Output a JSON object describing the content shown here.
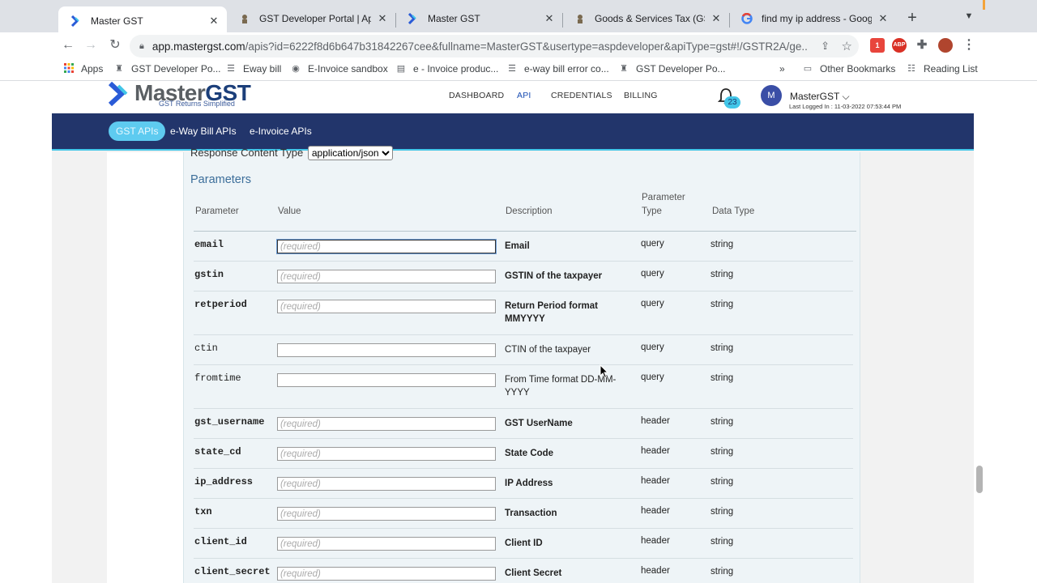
{
  "browser": {
    "tabs": [
      {
        "title": "Master GST",
        "favicon": "mastergst-favicon"
      },
      {
        "title": "GST Developer Portal | Apilist",
        "favicon": "gst-emblem-favicon"
      },
      {
        "title": "Master GST",
        "favicon": "mastergst-favicon"
      },
      {
        "title": "Goods & Services Tax (GST) | ",
        "favicon": "gst-emblem-favicon"
      },
      {
        "title": "find my ip address - Google Se",
        "favicon": "google-favicon"
      }
    ],
    "url_host": "app.mastergst.com",
    "url_rest": "/apis?id=6222f8d6b647b31842267cee&fullname=MasterGST&usertype=aspdeveloper&apiType=gst#!/GSTR2A/ge...",
    "bookmarks": [
      {
        "label": "Apps",
        "icon": "apps-grid-icon"
      },
      {
        "label": "GST Developer Po...",
        "icon": "gst-emblem-icon"
      },
      {
        "label": "Eway bill",
        "icon": "bookmark-icon"
      },
      {
        "label": "E-Invoice sandbox",
        "icon": "globe-icon"
      },
      {
        "label": "e - Invoice produc...",
        "icon": "page-icon"
      },
      {
        "label": "e-way bill error co...",
        "icon": "bookmark-icon"
      },
      {
        "label": "GST Developer Po...",
        "icon": "gst-emblem-icon"
      }
    ],
    "more_bookmarks": "»",
    "other_bookmarks": "Other Bookmarks",
    "reading_list": "Reading List",
    "ext_badge": "1",
    "abp": "ABP"
  },
  "site": {
    "logo_word_prefix": "Master",
    "logo_word_suffix": "GST",
    "logo_tagline": "GST Returns Simplified",
    "nav": [
      {
        "label": "DASHBOARD",
        "active": false
      },
      {
        "label": "API",
        "active": true
      },
      {
        "label": "CREDENTIALS",
        "active": false
      },
      {
        "label": "BILLING",
        "active": false
      }
    ],
    "notifications": "23",
    "avatar_letter": "M",
    "user_name": "MasterGST",
    "last_logged": "Last Logged In : 11-03-2022 07:53:44 PM",
    "subnav": [
      {
        "label": "GST APIs",
        "active": true
      },
      {
        "label": "e-Way Bill APIs",
        "active": false
      },
      {
        "label": "e-Invoice APIs",
        "active": false
      }
    ],
    "colors": {
      "navy": "#22356b",
      "accent": "#42c6e8",
      "link": "#1a4db3"
    }
  },
  "content": {
    "response_content_type_label": "Response Content Type",
    "response_content_type_value": "application/json",
    "parameters_title": "Parameters",
    "headers": {
      "parameter": "Parameter",
      "value": "Value",
      "description": "Description",
      "parameter_type": "Parameter Type",
      "data_type": "Data Type"
    },
    "rows": [
      {
        "name": "email",
        "required": true,
        "placeholder": "(required)",
        "description": "Email",
        "param_type": "query",
        "data_type": "string",
        "focused": true
      },
      {
        "name": "gstin",
        "required": true,
        "placeholder": "(required)",
        "description": "GSTIN of the taxpayer",
        "param_type": "query",
        "data_type": "string"
      },
      {
        "name": "retperiod",
        "required": true,
        "placeholder": "(required)",
        "description": "Return Period format MMYYYY",
        "param_type": "query",
        "data_type": "string"
      },
      {
        "name": "ctin",
        "required": false,
        "placeholder": "",
        "description": "CTIN of the taxpayer",
        "param_type": "query",
        "data_type": "string"
      },
      {
        "name": "fromtime",
        "required": false,
        "placeholder": "",
        "description": "From Time format DD-MM-YYYY",
        "param_type": "query",
        "data_type": "string"
      },
      {
        "name": "gst_username",
        "required": true,
        "placeholder": "(required)",
        "description": "GST UserName",
        "param_type": "header",
        "data_type": "string"
      },
      {
        "name": "state_cd",
        "required": true,
        "placeholder": "(required)",
        "description": "State Code",
        "param_type": "header",
        "data_type": "string"
      },
      {
        "name": "ip_address",
        "required": true,
        "placeholder": "(required)",
        "description": "IP Address",
        "param_type": "header",
        "data_type": "string"
      },
      {
        "name": "txn",
        "required": true,
        "placeholder": "(required)",
        "description": "Transaction",
        "param_type": "header",
        "data_type": "string"
      },
      {
        "name": "client_id",
        "required": true,
        "placeholder": "(required)",
        "description": "Client ID",
        "param_type": "header",
        "data_type": "string"
      },
      {
        "name": "client_secret",
        "required": true,
        "placeholder": "(required)",
        "description": "Client Secret",
        "param_type": "header",
        "data_type": "string"
      }
    ]
  }
}
